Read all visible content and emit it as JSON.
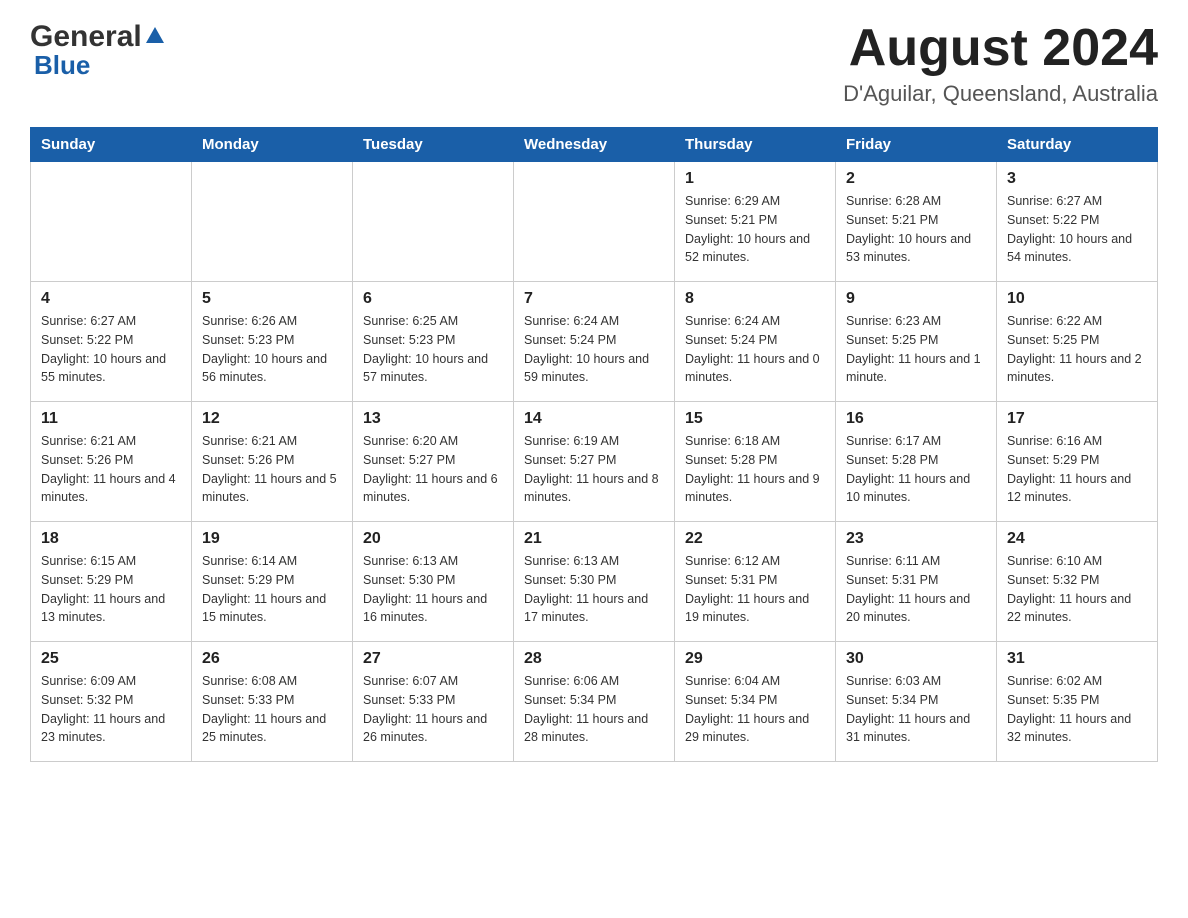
{
  "header": {
    "logo_general": "General",
    "logo_blue": "Blue",
    "title": "August 2024",
    "location": "D'Aguilar, Queensland, Australia"
  },
  "weekdays": [
    "Sunday",
    "Monday",
    "Tuesday",
    "Wednesday",
    "Thursday",
    "Friday",
    "Saturday"
  ],
  "weeks": [
    [
      {
        "day": "",
        "sunrise": "",
        "sunset": "",
        "daylight": ""
      },
      {
        "day": "",
        "sunrise": "",
        "sunset": "",
        "daylight": ""
      },
      {
        "day": "",
        "sunrise": "",
        "sunset": "",
        "daylight": ""
      },
      {
        "day": "",
        "sunrise": "",
        "sunset": "",
        "daylight": ""
      },
      {
        "day": "1",
        "sunrise": "Sunrise: 6:29 AM",
        "sunset": "Sunset: 5:21 PM",
        "daylight": "Daylight: 10 hours and 52 minutes."
      },
      {
        "day": "2",
        "sunrise": "Sunrise: 6:28 AM",
        "sunset": "Sunset: 5:21 PM",
        "daylight": "Daylight: 10 hours and 53 minutes."
      },
      {
        "day": "3",
        "sunrise": "Sunrise: 6:27 AM",
        "sunset": "Sunset: 5:22 PM",
        "daylight": "Daylight: 10 hours and 54 minutes."
      }
    ],
    [
      {
        "day": "4",
        "sunrise": "Sunrise: 6:27 AM",
        "sunset": "Sunset: 5:22 PM",
        "daylight": "Daylight: 10 hours and 55 minutes."
      },
      {
        "day": "5",
        "sunrise": "Sunrise: 6:26 AM",
        "sunset": "Sunset: 5:23 PM",
        "daylight": "Daylight: 10 hours and 56 minutes."
      },
      {
        "day": "6",
        "sunrise": "Sunrise: 6:25 AM",
        "sunset": "Sunset: 5:23 PM",
        "daylight": "Daylight: 10 hours and 57 minutes."
      },
      {
        "day": "7",
        "sunrise": "Sunrise: 6:24 AM",
        "sunset": "Sunset: 5:24 PM",
        "daylight": "Daylight: 10 hours and 59 minutes."
      },
      {
        "day": "8",
        "sunrise": "Sunrise: 6:24 AM",
        "sunset": "Sunset: 5:24 PM",
        "daylight": "Daylight: 11 hours and 0 minutes."
      },
      {
        "day": "9",
        "sunrise": "Sunrise: 6:23 AM",
        "sunset": "Sunset: 5:25 PM",
        "daylight": "Daylight: 11 hours and 1 minute."
      },
      {
        "day": "10",
        "sunrise": "Sunrise: 6:22 AM",
        "sunset": "Sunset: 5:25 PM",
        "daylight": "Daylight: 11 hours and 2 minutes."
      }
    ],
    [
      {
        "day": "11",
        "sunrise": "Sunrise: 6:21 AM",
        "sunset": "Sunset: 5:26 PM",
        "daylight": "Daylight: 11 hours and 4 minutes."
      },
      {
        "day": "12",
        "sunrise": "Sunrise: 6:21 AM",
        "sunset": "Sunset: 5:26 PM",
        "daylight": "Daylight: 11 hours and 5 minutes."
      },
      {
        "day": "13",
        "sunrise": "Sunrise: 6:20 AM",
        "sunset": "Sunset: 5:27 PM",
        "daylight": "Daylight: 11 hours and 6 minutes."
      },
      {
        "day": "14",
        "sunrise": "Sunrise: 6:19 AM",
        "sunset": "Sunset: 5:27 PM",
        "daylight": "Daylight: 11 hours and 8 minutes."
      },
      {
        "day": "15",
        "sunrise": "Sunrise: 6:18 AM",
        "sunset": "Sunset: 5:28 PM",
        "daylight": "Daylight: 11 hours and 9 minutes."
      },
      {
        "day": "16",
        "sunrise": "Sunrise: 6:17 AM",
        "sunset": "Sunset: 5:28 PM",
        "daylight": "Daylight: 11 hours and 10 minutes."
      },
      {
        "day": "17",
        "sunrise": "Sunrise: 6:16 AM",
        "sunset": "Sunset: 5:29 PM",
        "daylight": "Daylight: 11 hours and 12 minutes."
      }
    ],
    [
      {
        "day": "18",
        "sunrise": "Sunrise: 6:15 AM",
        "sunset": "Sunset: 5:29 PM",
        "daylight": "Daylight: 11 hours and 13 minutes."
      },
      {
        "day": "19",
        "sunrise": "Sunrise: 6:14 AM",
        "sunset": "Sunset: 5:29 PM",
        "daylight": "Daylight: 11 hours and 15 minutes."
      },
      {
        "day": "20",
        "sunrise": "Sunrise: 6:13 AM",
        "sunset": "Sunset: 5:30 PM",
        "daylight": "Daylight: 11 hours and 16 minutes."
      },
      {
        "day": "21",
        "sunrise": "Sunrise: 6:13 AM",
        "sunset": "Sunset: 5:30 PM",
        "daylight": "Daylight: 11 hours and 17 minutes."
      },
      {
        "day": "22",
        "sunrise": "Sunrise: 6:12 AM",
        "sunset": "Sunset: 5:31 PM",
        "daylight": "Daylight: 11 hours and 19 minutes."
      },
      {
        "day": "23",
        "sunrise": "Sunrise: 6:11 AM",
        "sunset": "Sunset: 5:31 PM",
        "daylight": "Daylight: 11 hours and 20 minutes."
      },
      {
        "day": "24",
        "sunrise": "Sunrise: 6:10 AM",
        "sunset": "Sunset: 5:32 PM",
        "daylight": "Daylight: 11 hours and 22 minutes."
      }
    ],
    [
      {
        "day": "25",
        "sunrise": "Sunrise: 6:09 AM",
        "sunset": "Sunset: 5:32 PM",
        "daylight": "Daylight: 11 hours and 23 minutes."
      },
      {
        "day": "26",
        "sunrise": "Sunrise: 6:08 AM",
        "sunset": "Sunset: 5:33 PM",
        "daylight": "Daylight: 11 hours and 25 minutes."
      },
      {
        "day": "27",
        "sunrise": "Sunrise: 6:07 AM",
        "sunset": "Sunset: 5:33 PM",
        "daylight": "Daylight: 11 hours and 26 minutes."
      },
      {
        "day": "28",
        "sunrise": "Sunrise: 6:06 AM",
        "sunset": "Sunset: 5:34 PM",
        "daylight": "Daylight: 11 hours and 28 minutes."
      },
      {
        "day": "29",
        "sunrise": "Sunrise: 6:04 AM",
        "sunset": "Sunset: 5:34 PM",
        "daylight": "Daylight: 11 hours and 29 minutes."
      },
      {
        "day": "30",
        "sunrise": "Sunrise: 6:03 AM",
        "sunset": "Sunset: 5:34 PM",
        "daylight": "Daylight: 11 hours and 31 minutes."
      },
      {
        "day": "31",
        "sunrise": "Sunrise: 6:02 AM",
        "sunset": "Sunset: 5:35 PM",
        "daylight": "Daylight: 11 hours and 32 minutes."
      }
    ]
  ]
}
